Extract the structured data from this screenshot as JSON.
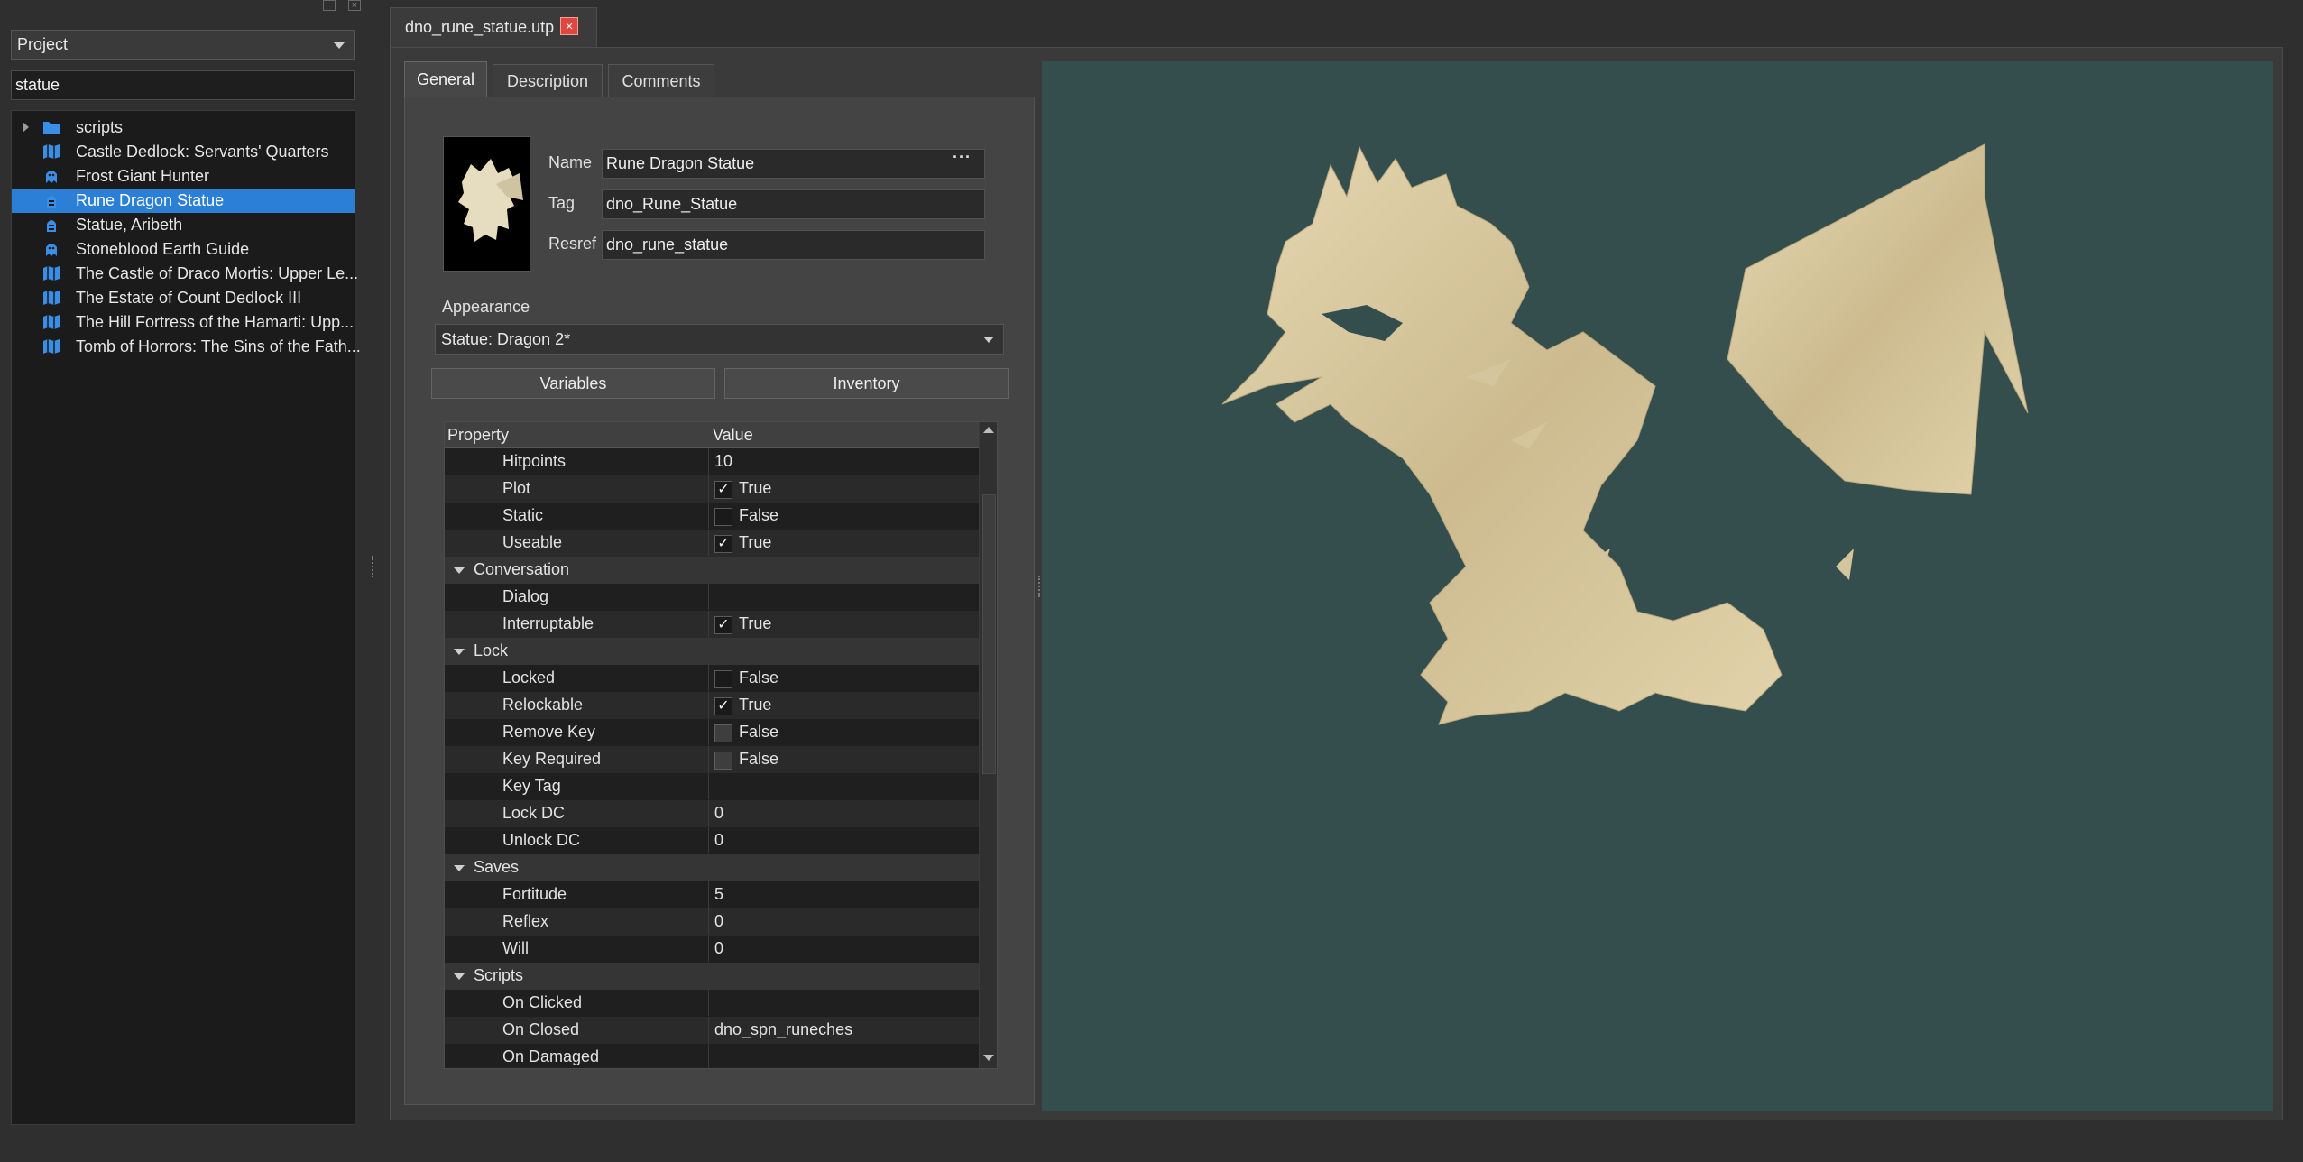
{
  "project_panel": {
    "selector_value": "Project",
    "search_value": "statue",
    "items": [
      {
        "label": "scripts",
        "icon": "folder-icon",
        "color": "#3a8ee6"
      },
      {
        "label": "Castle Dedlock: Servants' Quarters",
        "icon": "map-icon",
        "color": "#3a8ee6"
      },
      {
        "label": "Frost Giant Hunter",
        "icon": "creature-icon",
        "color": "#3a8ee6"
      },
      {
        "label": "Rune Dragon Statue",
        "icon": "placeable-icon",
        "color": "#3a8ee6"
      },
      {
        "label": "Statue, Aribeth",
        "icon": "placeable-icon",
        "color": "#3a8ee6"
      },
      {
        "label": "Stoneblood Earth Guide",
        "icon": "creature-icon",
        "color": "#3a8ee6"
      },
      {
        "label": "The Castle of Draco Mortis: Upper Le...",
        "icon": "map-icon",
        "color": "#3a8ee6"
      },
      {
        "label": "The Estate of Count Dedlock III",
        "icon": "map-icon",
        "color": "#3a8ee6"
      },
      {
        "label": "The Hill Fortress of the Hamarti: Upp...",
        "icon": "map-icon",
        "color": "#3a8ee6"
      },
      {
        "label": "Tomb of Horrors: The Sins of the Fath...",
        "icon": "map-icon",
        "color": "#3a8ee6"
      }
    ],
    "selected_item": "Rune Dragon Statue"
  },
  "document_tab": {
    "title": "dno_rune_statue.utp",
    "close_icon": "close-icon"
  },
  "editor": {
    "tabs": [
      "General",
      "Description",
      "Comments"
    ],
    "active_tab": "General",
    "fields": {
      "name_label": "Name",
      "name_value": "Rune Dragon Statue",
      "name_button": "···",
      "tag_label": "Tag",
      "tag_value": "dno_Rune_Statue",
      "resref_label": "Resref",
      "resref_value": "dno_rune_statue"
    },
    "appearance_label": "Appearance",
    "appearance_value": "Statue: Dragon 2*",
    "variables_button": "Variables",
    "inventory_button": "Inventory",
    "grid": {
      "header_property": "Property",
      "header_value": "Value",
      "rows": [
        {
          "type": "prop",
          "name": "Hitpoints",
          "value": "10"
        },
        {
          "type": "prop",
          "name": "Plot",
          "value": "True",
          "check": "checked"
        },
        {
          "type": "prop",
          "name": "Static",
          "value": "False",
          "check": "unchecked"
        },
        {
          "type": "prop",
          "name": "Useable",
          "value": "True",
          "check": "checked"
        },
        {
          "type": "group",
          "name": "Conversation"
        },
        {
          "type": "prop",
          "name": "Dialog",
          "value": ""
        },
        {
          "type": "prop",
          "name": "Interruptable",
          "value": "True",
          "check": "checked"
        },
        {
          "type": "group",
          "name": "Lock"
        },
        {
          "type": "prop",
          "name": "Locked",
          "value": "False",
          "check": "unchecked"
        },
        {
          "type": "prop",
          "name": "Relockable",
          "value": "True",
          "check": "checked"
        },
        {
          "type": "prop",
          "name": "Remove Key",
          "value": "False",
          "check": "disabled"
        },
        {
          "type": "prop",
          "name": "Key Required",
          "value": "False",
          "check": "disabled"
        },
        {
          "type": "prop",
          "name": "Key Tag",
          "value": ""
        },
        {
          "type": "prop",
          "name": "Lock DC",
          "value": "0"
        },
        {
          "type": "prop",
          "name": "Unlock DC",
          "value": "0"
        },
        {
          "type": "group",
          "name": "Saves"
        },
        {
          "type": "prop",
          "name": "Fortitude",
          "value": "5"
        },
        {
          "type": "prop",
          "name": "Reflex",
          "value": "0"
        },
        {
          "type": "prop",
          "name": "Will",
          "value": "0"
        },
        {
          "type": "group",
          "name": "Scripts"
        },
        {
          "type": "prop",
          "name": "On Clicked",
          "value": ""
        },
        {
          "type": "prop",
          "name": "On Closed",
          "value": "dno_spn_runeches"
        },
        {
          "type": "prop",
          "name": "On Damaged",
          "value": ""
        }
      ]
    }
  },
  "viewport": {
    "background": "#334e4d",
    "model_color": "#d9c9a0"
  }
}
